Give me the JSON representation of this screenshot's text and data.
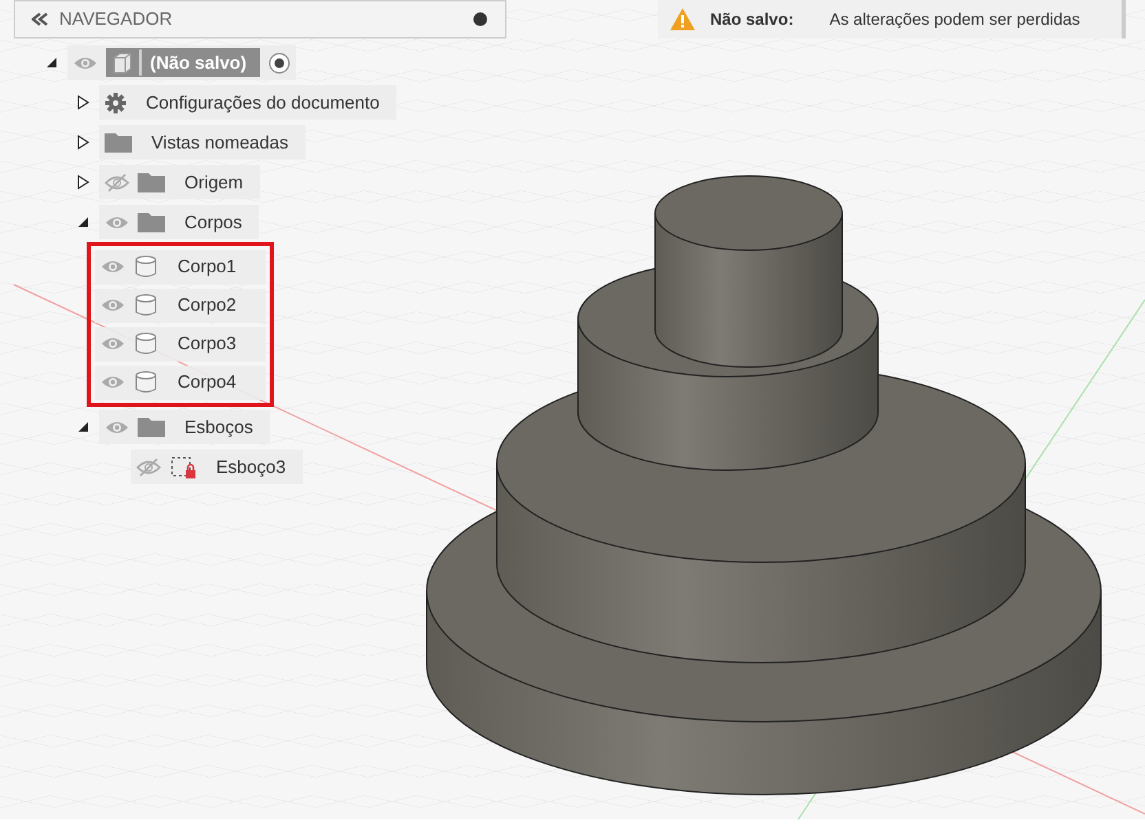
{
  "navigator": {
    "title": "NAVEGADOR"
  },
  "notice": {
    "title": "Não salvo:",
    "message": "As alterações podem ser perdidas"
  },
  "tree": [
    {
      "label": "(Não salvo)",
      "kind": "component",
      "expanded": true,
      "visible": true,
      "active": true,
      "children": [
        {
          "label": "Configurações do documento",
          "kind": "settings",
          "expanded": false
        },
        {
          "label": "Vistas nomeadas",
          "kind": "folder",
          "expanded": false
        },
        {
          "label": "Origem",
          "kind": "folder",
          "expanded": false,
          "visible": false
        },
        {
          "label": "Corpos",
          "kind": "folder",
          "expanded": true,
          "visible": true,
          "highlighted": true,
          "children": [
            {
              "label": "Corpo1",
              "kind": "body",
              "visible": true
            },
            {
              "label": "Corpo2",
              "kind": "body",
              "visible": true
            },
            {
              "label": "Corpo3",
              "kind": "body",
              "visible": true
            },
            {
              "label": "Corpo4",
              "kind": "body",
              "visible": true
            }
          ]
        },
        {
          "label": "Esboços",
          "kind": "folder",
          "expanded": true,
          "visible": true,
          "children": [
            {
              "label": "Esboço3",
              "kind": "sketch",
              "visible": false
            }
          ]
        }
      ]
    }
  ]
}
